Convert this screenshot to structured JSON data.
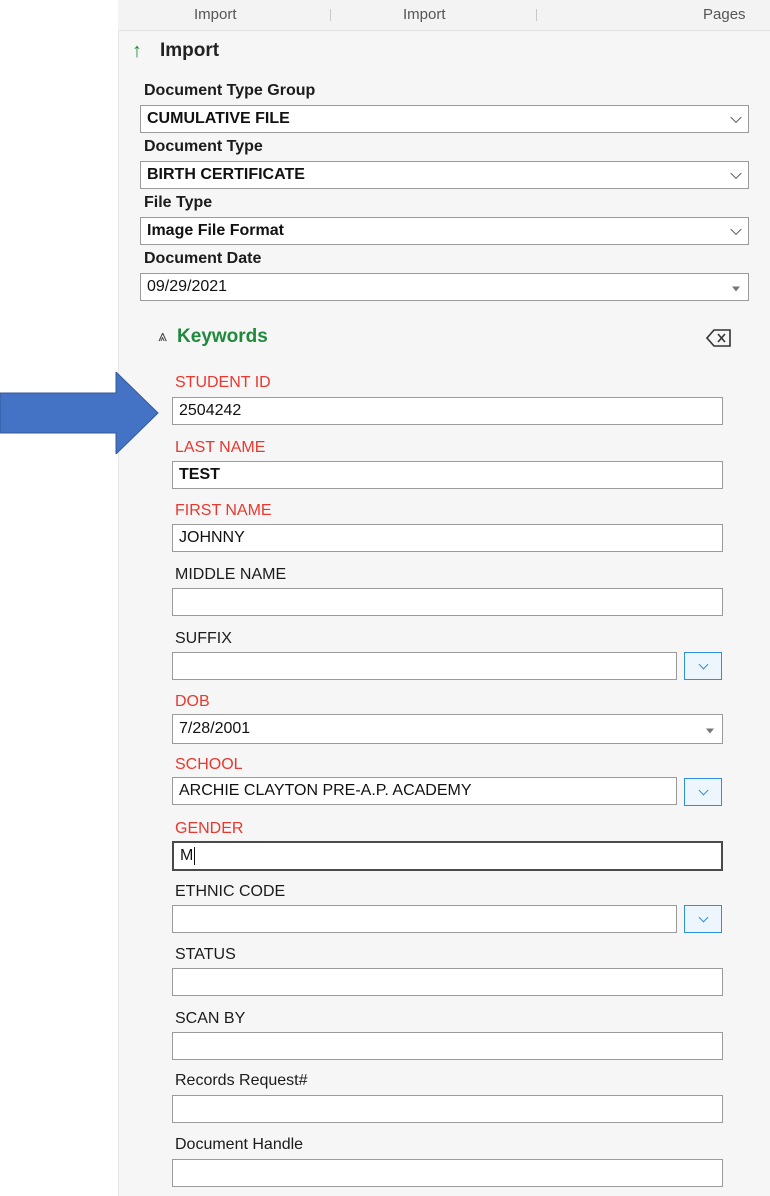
{
  "tabs": [
    "Import",
    "Import",
    "Pages"
  ],
  "section": {
    "title": "Import"
  },
  "top_fields": [
    {
      "label": "Document Type Group",
      "value": "CUMULATIVE FILE"
    },
    {
      "label": "Document Type",
      "value": "BIRTH CERTIFICATE"
    },
    {
      "label": "File Type",
      "value": "Image File Format"
    },
    {
      "label": "Document Date",
      "value": "09/29/2021"
    }
  ],
  "keywords": {
    "title": "Keywords",
    "fields": [
      {
        "label": "STUDENT ID",
        "value": "2504242",
        "required": true
      },
      {
        "label": "LAST NAME",
        "value": "TEST",
        "required": true
      },
      {
        "label": "FIRST NAME",
        "value": "JOHNNY",
        "required": true
      },
      {
        "label": "MIDDLE NAME",
        "value": "",
        "required": false
      },
      {
        "label": "SUFFIX",
        "value": "",
        "required": false
      },
      {
        "label": "DOB",
        "value": "7/28/2001",
        "required": true
      },
      {
        "label": "SCHOOL",
        "value": "ARCHIE CLAYTON PRE-A.P. ACADEMY",
        "required": true
      },
      {
        "label": "GENDER",
        "value": "M",
        "required": true
      },
      {
        "label": "ETHNIC CODE",
        "value": "",
        "required": false
      },
      {
        "label": "STATUS",
        "value": "",
        "required": false
      },
      {
        "label": "SCAN BY",
        "value": "",
        "required": false
      },
      {
        "label": "Records Request#",
        "value": "",
        "required": false
      },
      {
        "label": "Document Handle",
        "value": "",
        "required": false
      }
    ]
  },
  "colors": {
    "required_label": "#e8382f",
    "accent_green": "#1f8a3b",
    "dropdown_blue": "#2f8fd8",
    "arrow_blue": "#4472c4"
  },
  "icons": {
    "import": "up-arrow-icon",
    "collapse": "double-chevron-up-icon",
    "clear": "clear-backspace-icon",
    "pointer": "blue-right-arrow"
  }
}
